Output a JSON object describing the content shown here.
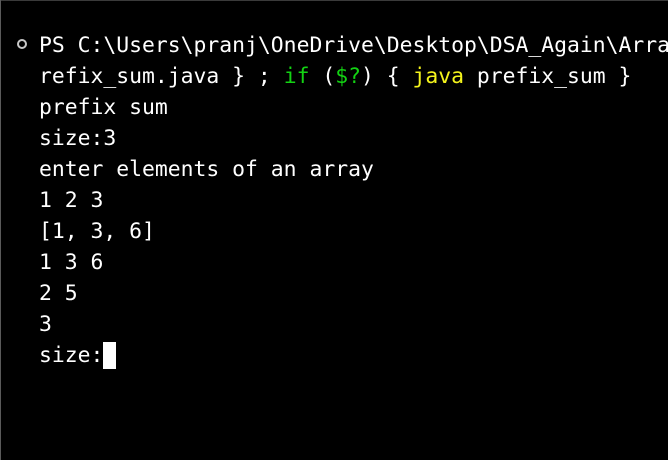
{
  "terminal": {
    "prompt_line": {
      "text": "PS C:\\Users\\pranj\\OneDrive\\Desktop\\DSA_Again\\Arra"
    },
    "command_line": {
      "part1": "refix_sum.java } ; ",
      "kw_if": "if",
      "part2": " (",
      "kw_status": "$?",
      "part3": ") { ",
      "kw_java": "java",
      "part4": " prefix_sum }"
    },
    "output_lines": [
      "prefix sum",
      "size:3",
      "enter elements of an array",
      "1 2 3",
      "[1, 3, 6]",
      "1 3 6",
      "2 5",
      "3"
    ],
    "input_prompt": "size:"
  },
  "colors": {
    "background": "#000000",
    "text": "#ffffff",
    "keyword_green": "#13d313",
    "keyword_yellow": "#f4f41c"
  }
}
